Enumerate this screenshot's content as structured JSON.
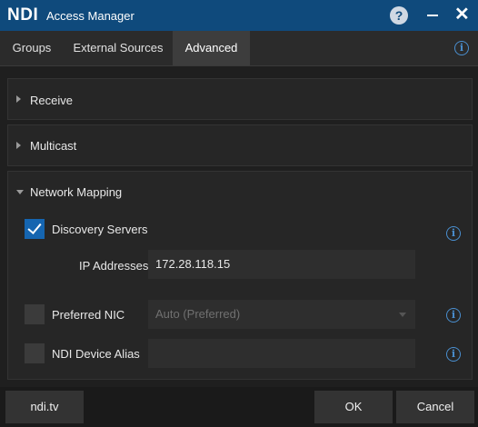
{
  "titlebar": {
    "logo": "NDI",
    "title": "Access Manager",
    "help_glyph": "?",
    "close_glyph": "✕"
  },
  "tabs": [
    {
      "label": "Groups",
      "active": false
    },
    {
      "label": "External Sources",
      "active": false
    },
    {
      "label": "Advanced",
      "active": true
    }
  ],
  "info_glyph": "i",
  "sections": {
    "receive": {
      "label": "Receive",
      "expanded": false
    },
    "multicast": {
      "label": "Multicast",
      "expanded": false
    },
    "network_mapping": {
      "label": "Network Mapping",
      "expanded": true
    }
  },
  "network_mapping": {
    "discovery_servers": {
      "label": "Discovery Servers",
      "checked": true
    },
    "ip_addresses": {
      "label": "IP Addresses",
      "value": "172.28.118.15"
    },
    "preferred_nic": {
      "label": "Preferred NIC",
      "checked": false,
      "value": "Auto (Preferred)"
    },
    "ndi_device_alias": {
      "label": "NDI Device Alias",
      "checked": false,
      "value": ""
    }
  },
  "footer": {
    "link_label": "ndi.tv",
    "ok_label": "OK",
    "cancel_label": "Cancel"
  },
  "colors": {
    "titlebar": "#0f4a7c",
    "accent": "#1565b0",
    "info": "#4a8fd0",
    "background": "#1f1f1f"
  }
}
